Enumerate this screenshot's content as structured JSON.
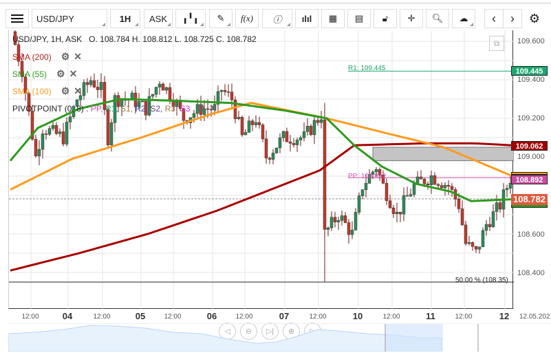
{
  "toolbar": {
    "symbol": "USD/JPY",
    "timeframe": "1H",
    "price_type": "ASK",
    "icons": [
      "menu-icon",
      "candles-icon",
      "pencil-icon",
      "fx-icon",
      "info-icon",
      "bar-chart-icon",
      "calendar-icon",
      "news-icon",
      "lock-icon",
      "crosshair-icon",
      "zoom-chart-icon",
      "cloud-upload-icon",
      "prev-icon",
      "next-icon",
      "gear-icon"
    ],
    "fx": "f(x)"
  },
  "header": {
    "title": "USD/JPY, 1H, ASK",
    "ohlc": "O. 108.784 H. 108.812 L. 108.725 C. 108.782"
  },
  "indicators": [
    {
      "label": "SMA (200)",
      "color": "#b22222"
    },
    {
      "label": "SMA (55)",
      "color": "#2e9a1e"
    },
    {
      "label": "SMA (100)",
      "color": "#ff9a1e"
    }
  ],
  "pivot": {
    "label": "PIVOTPOINT (0, 8)",
    "sep": ":",
    "items": [
      {
        "t": "PP,",
        "c": "#d050b0"
      },
      {
        "t": "R1,",
        "c": "#20b080"
      },
      {
        "t": "S1,",
        "c": "#a07840"
      },
      {
        "t": "R2,",
        "c": "#3050c0"
      },
      {
        "t": "S2,",
        "c": "#604080"
      },
      {
        "t": "R3,",
        "c": "#a07840"
      },
      {
        "t": "S3",
        "c": "#e030e0"
      }
    ]
  },
  "levels": {
    "r1_label": "R1: 109.445",
    "pp_label": "PP: 108.892",
    "fib_label": "50.00 % (108.35)"
  },
  "price_tags": {
    "r1": "109.445",
    "sma200": "109.062",
    "pp": "108.892",
    "current": "108.782"
  },
  "y_axis": [
    "109.600",
    "109.400",
    "109.200",
    "109.000",
    "108.600",
    "108.400"
  ],
  "x_axis": [
    {
      "t": "12:00",
      "b": false
    },
    {
      "t": "04",
      "b": true
    },
    {
      "t": "12:00",
      "b": false
    },
    {
      "t": "05",
      "b": true
    },
    {
      "t": "12:00",
      "b": false
    },
    {
      "t": "06",
      "b": true
    },
    {
      "t": "12:00",
      "b": false
    },
    {
      "t": "07",
      "b": true
    },
    {
      "t": "12:00",
      "b": false
    },
    {
      "t": "10",
      "b": true
    },
    {
      "t": "12:00",
      "b": false
    },
    {
      "t": "11",
      "b": true
    },
    {
      "t": "12:00",
      "b": false
    },
    {
      "t": "12",
      "b": true
    }
  ],
  "date_label": "12.05.2021",
  "chart_data": {
    "type": "candlestick",
    "anchors": [
      [
        0,
        109.65
      ],
      [
        3,
        109.45
      ],
      [
        7,
        109.0
      ],
      [
        9,
        109.15
      ],
      [
        15,
        109.1
      ],
      [
        17,
        109.2
      ],
      [
        19,
        109.3
      ],
      [
        23,
        109.4
      ],
      [
        26,
        109.35
      ],
      [
        28,
        109.1
      ],
      [
        30,
        109.3
      ],
      [
        35,
        109.3
      ],
      [
        39,
        109.25
      ],
      [
        43,
        109.4
      ],
      [
        47,
        109.3
      ],
      [
        50,
        109.2
      ],
      [
        55,
        109.25
      ],
      [
        59,
        109.25
      ],
      [
        61,
        109.35
      ],
      [
        64,
        109.3
      ],
      [
        67,
        109.1
      ],
      [
        71,
        109.2
      ],
      [
        74,
        109.0
      ],
      [
        79,
        109.1
      ],
      [
        85,
        109.1
      ],
      [
        90,
        109.22
      ],
      [
        91,
        108.6
      ],
      [
        95,
        108.7
      ],
      [
        99,
        108.6
      ],
      [
        102,
        108.85
      ],
      [
        106,
        108.95
      ],
      [
        108,
        108.85
      ],
      [
        112,
        108.7
      ],
      [
        117,
        108.85
      ],
      [
        122,
        108.9
      ],
      [
        127,
        108.85
      ],
      [
        130,
        108.75
      ],
      [
        132,
        108.55
      ],
      [
        135,
        108.5
      ],
      [
        138,
        108.65
      ],
      [
        142,
        108.75
      ],
      [
        145,
        108.89
      ]
    ],
    "sma200": [
      [
        0,
        108.41
      ],
      [
        20,
        108.5
      ],
      [
        40,
        108.6
      ],
      [
        60,
        108.72
      ],
      [
        80,
        108.86
      ],
      [
        90,
        108.93
      ],
      [
        100,
        109.06
      ],
      [
        120,
        109.07
      ],
      [
        135,
        109.07
      ],
      [
        146,
        109.06
      ]
    ],
    "sma55": [
      [
        0,
        108.98
      ],
      [
        8,
        109.15
      ],
      [
        20,
        109.25
      ],
      [
        32,
        109.3
      ],
      [
        50,
        109.29
      ],
      [
        64,
        109.28
      ],
      [
        80,
        109.24
      ],
      [
        92,
        109.2
      ],
      [
        100,
        109.06
      ],
      [
        108,
        108.95
      ],
      [
        118,
        108.86
      ],
      [
        128,
        108.82
      ],
      [
        134,
        108.77
      ],
      [
        146,
        108.78
      ]
    ],
    "sma100": [
      [
        0,
        108.83
      ],
      [
        18,
        108.99
      ],
      [
        38,
        109.1
      ],
      [
        58,
        109.22
      ],
      [
        70,
        109.28
      ],
      [
        92,
        109.2
      ],
      [
        110,
        109.12
      ],
      [
        126,
        109.05
      ],
      [
        138,
        108.96
      ],
      [
        146,
        108.9
      ]
    ],
    "zone": [
      108.98,
      109.05
    ]
  },
  "nav_buttons": [
    "◁",
    "⊖",
    "▷|",
    "⊕",
    "▷"
  ]
}
